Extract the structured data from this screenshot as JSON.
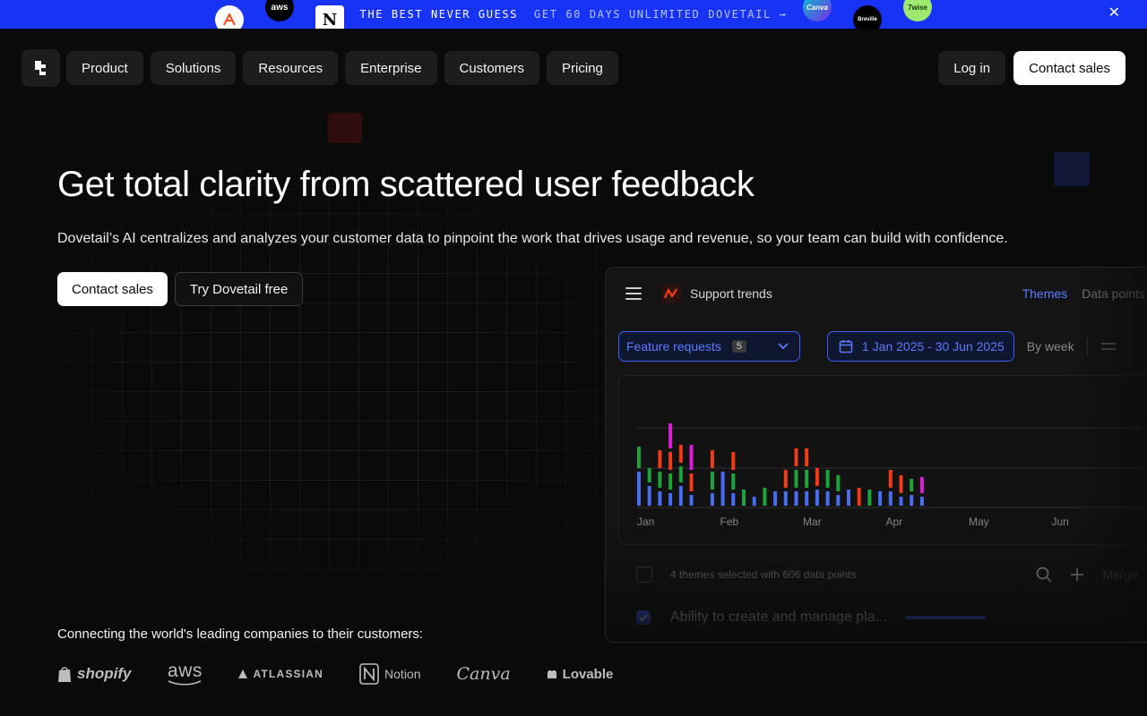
{
  "banner": {
    "main_text": "THE BEST NEVER GUESS",
    "cta_text": "GET 60 DAYS UNLIMITED DOVETAIL →",
    "close_label": "✕",
    "logos": [
      "aws",
      "N",
      "Canva",
      "Breville",
      "7wise"
    ]
  },
  "nav": {
    "items": [
      "Product",
      "Solutions",
      "Resources",
      "Enterprise",
      "Customers",
      "Pricing"
    ],
    "login": "Log in",
    "contact": "Contact sales"
  },
  "hero": {
    "title": "Get total clarity from scattered user feedback",
    "subtitle": "Dovetail’s AI centralizes and analyzes your customer data to pinpoint the work that drives usage and revenue, so your team can build with confidence.",
    "cta_primary": "Contact sales",
    "cta_secondary": "Try Dovetail free"
  },
  "panel": {
    "title": "Support trends",
    "tabs": [
      "Themes",
      "Data points"
    ],
    "filter_label": "Feature requests",
    "filter_count": "5",
    "date_range": "1 Jan 2025 - 30 Jun 2025",
    "interval": "By week",
    "list_summary": "4 themes selected with 606 data points",
    "merge_label": "Merge",
    "row_text": "Ability to create and manage pla..."
  },
  "chart_data": {
    "type": "bar",
    "x": [
      "Jan",
      "Feb",
      "Mar",
      "Apr",
      "May",
      "Jun"
    ],
    "colors": {
      "blue": "#4a6cf0",
      "green": "#1ea33a",
      "red": "#ef3b1a",
      "magenta": "#d81fd6"
    },
    "series": [
      {
        "color": "blue",
        "values": [
          40,
          24,
          18,
          16,
          24,
          14,
          0,
          16,
          40,
          16,
          0,
          12,
          0,
          18,
          18,
          18,
          18,
          20,
          18,
          14,
          20,
          0,
          0,
          18,
          18,
          12,
          14,
          12
        ]
      },
      {
        "color": "green",
        "values": [
          26,
          18,
          20,
          20,
          20,
          0,
          0,
          22,
          0,
          20,
          20,
          0,
          22,
          0,
          0,
          22,
          22,
          0,
          22,
          20,
          0,
          0,
          20,
          0,
          0,
          0,
          16,
          0
        ]
      },
      {
        "color": "red",
        "values": [
          0,
          0,
          22,
          22,
          22,
          22,
          0,
          22,
          0,
          22,
          0,
          0,
          0,
          0,
          22,
          22,
          22,
          22,
          0,
          0,
          0,
          22,
          0,
          0,
          22,
          22,
          0,
          0
        ]
      },
      {
        "color": "magenta",
        "values": [
          0,
          0,
          0,
          30,
          0,
          30,
          0,
          0,
          0,
          0,
          0,
          0,
          0,
          0,
          0,
          0,
          0,
          0,
          0,
          0,
          0,
          0,
          0,
          0,
          0,
          0,
          0,
          20
        ]
      }
    ]
  },
  "logos_strip": {
    "caption": "Connecting the world's leading companies to their customers:",
    "items": [
      "shopify",
      "aws",
      "ATLASSIAN",
      "Notion",
      "Canva",
      "Lovable"
    ]
  }
}
